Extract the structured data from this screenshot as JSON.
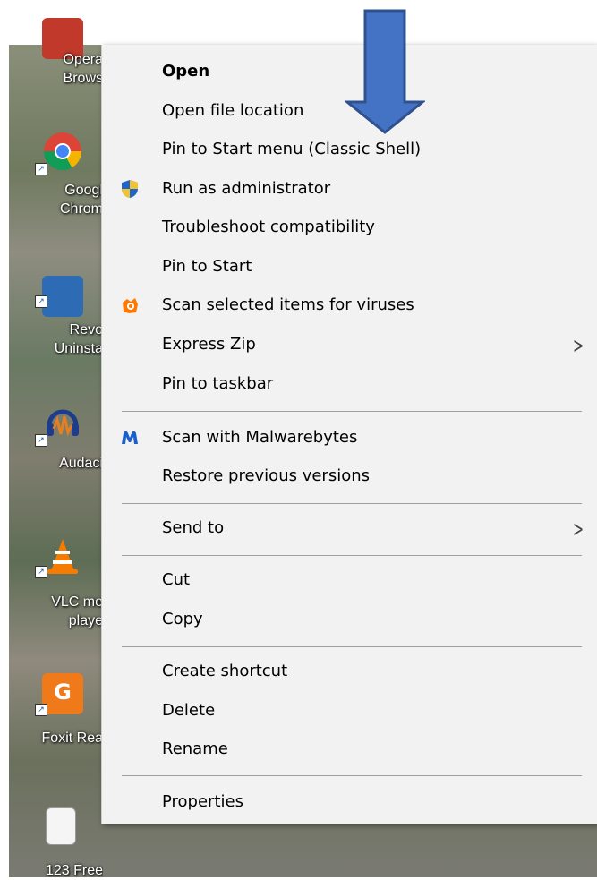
{
  "desktop": {
    "icons": [
      {
        "name": "opera",
        "label": "Opera\nBrows",
        "color": "#c0392b"
      },
      {
        "name": "chrome",
        "label": "Googl\nChrom",
        "color": "#2e8b57"
      },
      {
        "name": "revo",
        "label": "Revo\nUninsta",
        "color": "#2d6bb5"
      },
      {
        "name": "audacity",
        "label": "Audaci",
        "color": "#f39c12"
      },
      {
        "name": "vlc",
        "label": "VLC me\nplaye",
        "color": "#f57c00"
      },
      {
        "name": "foxit",
        "label": "Foxit Rea",
        "color": "#f07a1a"
      },
      {
        "name": "solitaire",
        "label": "123 Free",
        "color": "#e8e8e8"
      }
    ]
  },
  "menu": {
    "items": [
      {
        "label": "Open",
        "bold": true
      },
      {
        "label": "Open file location"
      },
      {
        "label": "Pin to Start menu (Classic Shell)"
      },
      {
        "label": "Run as administrator",
        "icon": "uac-shield-icon"
      },
      {
        "label": "Troubleshoot compatibility"
      },
      {
        "label": "Pin to Start"
      },
      {
        "label": "Scan selected items for viruses",
        "icon": "avast-icon"
      },
      {
        "label": "Express Zip",
        "submenu": true
      },
      {
        "label": "Pin to taskbar"
      },
      {
        "label": "Scan with Malwarebytes",
        "icon": "malwarebytes-icon"
      },
      {
        "label": "Restore previous versions"
      },
      {
        "label": "Send to",
        "submenu": true
      },
      {
        "label": "Cut"
      },
      {
        "label": "Copy"
      },
      {
        "label": "Create shortcut"
      },
      {
        "label": "Delete"
      },
      {
        "label": "Rename"
      },
      {
        "label": "Properties"
      }
    ],
    "submenu_glyph": ">"
  },
  "annotation": {
    "arrow_color": "#4472c4",
    "arrow_border": "#2f528f",
    "icon": "down-arrow-icon"
  },
  "colors": {
    "menu_bg": "#f2f2f2",
    "separator": "#a0a0a0",
    "text": "#000000"
  }
}
